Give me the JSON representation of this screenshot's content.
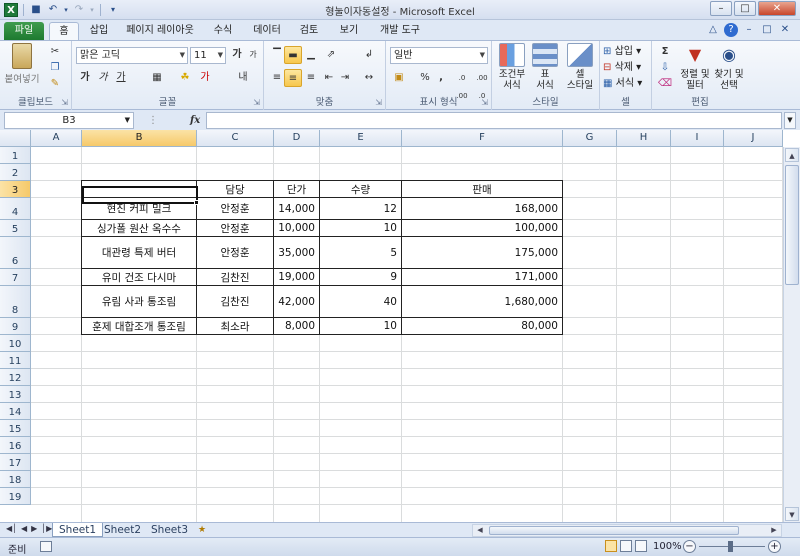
{
  "title": "형눌이자동설정  -  Microsoft Excel",
  "quick_access": [
    "save-icon",
    "undo-icon",
    "redo-icon"
  ],
  "tabs": [
    "파일",
    "홈",
    "삽입",
    "페이지 레이아웃",
    "수식",
    "데이터",
    "검토",
    "보기",
    "개발 도구"
  ],
  "active_tab": "홈",
  "ribbon": {
    "clipboard": {
      "paste": "붙여넣기",
      "label": "클립보드"
    },
    "font": {
      "name": "맑은 고딕",
      "size": "11",
      "bold": "가",
      "italic": "가",
      "underline": "가",
      "grow": "가",
      "shrink": "가",
      "label": "글꼴",
      "shading": "가",
      "phonetic": "내"
    },
    "alignment": {
      "label": "맞춤"
    },
    "number": {
      "format": "일반",
      "percent": "%",
      "comma": ",",
      "inc": ".0 .00",
      "dec": ".00 .0",
      "label": "표시 형식"
    },
    "styles": {
      "conditional": "조건부\n서식",
      "table": "표\n서식",
      "cell": "셀\n스타일",
      "label": "스타일"
    },
    "cells": {
      "insert": "삽입",
      "delete": "삭제",
      "format": "서식",
      "label": "셀"
    },
    "editing": {
      "sort": "정렬 및\n필터",
      "find": "찾기 및\n선택",
      "label": "편집"
    }
  },
  "formula_bar": {
    "name_box": "B3",
    "fx": "fx",
    "formula": ""
  },
  "columns": [
    "A",
    "B",
    "C",
    "D",
    "E",
    "F",
    "G",
    "H",
    "I",
    "J"
  ],
  "rows": [
    "1",
    "2",
    "3",
    "4",
    "5",
    "6",
    "7",
    "8",
    "9",
    "10",
    "11",
    "12",
    "13",
    "14",
    "15",
    "16",
    "17",
    "18",
    "19"
  ],
  "selected_cell": "B3",
  "table": {
    "headers": [
      "",
      "담당",
      "단가",
      "수량",
      "판매"
    ],
    "rows": [
      [
        "현진 커피 밀크",
        "안정훈",
        "14,000",
        "12",
        "168,000"
      ],
      [
        "싱가폴 원산 옥수수",
        "안정훈",
        "10,000",
        "10",
        "100,000"
      ],
      [
        "대관령 특제 버터",
        "안정훈",
        "35,000",
        "5",
        "175,000"
      ],
      [
        "유미 건조 다시마",
        "김찬진",
        "19,000",
        "9",
        "171,000"
      ],
      [
        "유림 사과 통조림",
        "김찬진",
        "42,000",
        "40",
        "1,680,000"
      ],
      [
        "훈제 대합조개 통조림",
        "최소라",
        "8,000",
        "10",
        "80,000"
      ]
    ]
  },
  "sheets": [
    "Sheet1",
    "Sheet2",
    "Sheet3"
  ],
  "active_sheet": "Sheet1",
  "status": {
    "ready": "준비",
    "zoom": "100%"
  },
  "colors": {
    "accent": "#1e7a30",
    "selection_header": "#f6c96a"
  }
}
